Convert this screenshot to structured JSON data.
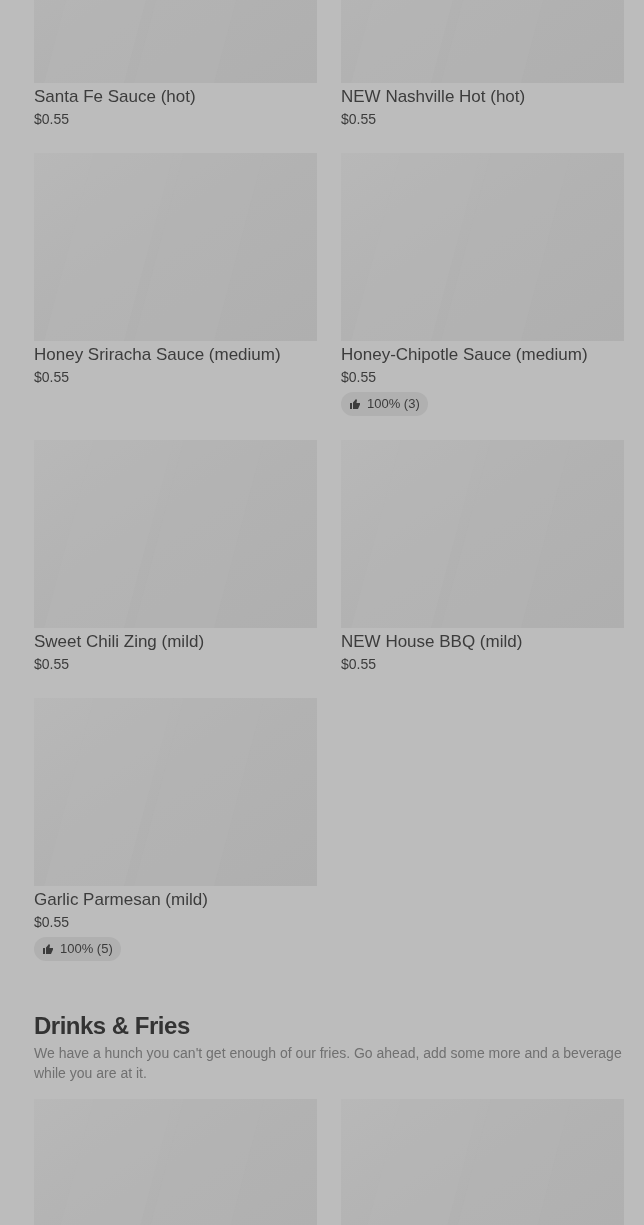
{
  "sections": [
    {
      "items": [
        {
          "name": "Santa Fe Sauce (hot)",
          "price": "$0.55"
        },
        {
          "name": "NEW Nashville Hot (hot)",
          "price": "$0.55"
        },
        {
          "name": "Honey Sriracha Sauce (medium)",
          "price": "$0.55"
        },
        {
          "name": "Honey-Chipotle Sauce (medium)",
          "price": "$0.55",
          "rating": "100% (3)"
        },
        {
          "name": "Sweet Chili Zing (mild)",
          "price": "$0.55"
        },
        {
          "name": "NEW House BBQ (mild)",
          "price": "$0.55"
        },
        {
          "name": "Garlic Parmesan (mild)",
          "price": "$0.55",
          "rating": "100% (5)"
        }
      ]
    },
    {
      "title": "Drinks & Fries",
      "description": "We have a hunch you can't get enough of our fries. Go ahead, add some more and a beverage while you are at it."
    }
  ]
}
